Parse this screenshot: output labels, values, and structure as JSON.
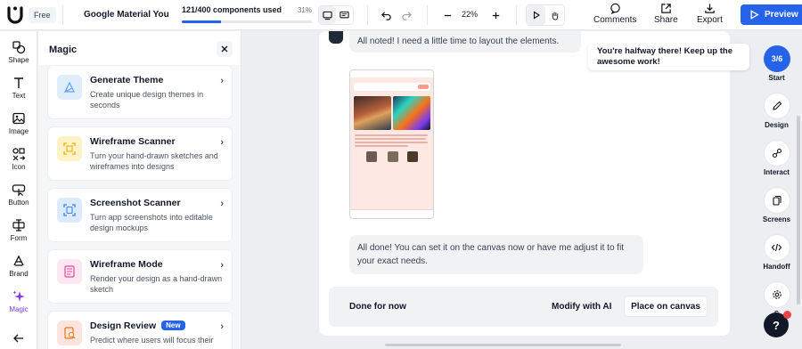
{
  "topbar": {
    "plan": "Free",
    "project_name": "Google Material You",
    "usage_text": "121/400 components used",
    "usage_percent": "31%",
    "usage_fraction": 0.3025,
    "zoom": "22%",
    "comments_label": "Comments",
    "share_label": "Share",
    "export_label": "Export",
    "preview_label": "Preview"
  },
  "rail": {
    "items": [
      {
        "label": "Shape",
        "icon": "shape-icon"
      },
      {
        "label": "Text",
        "icon": "text-icon"
      },
      {
        "label": "Image",
        "icon": "image-icon"
      },
      {
        "label": "Icon",
        "icon": "icon-icon"
      },
      {
        "label": "Button",
        "icon": "button-icon"
      },
      {
        "label": "Form",
        "icon": "form-icon"
      },
      {
        "label": "Brand",
        "icon": "brand-icon"
      },
      {
        "label": "Magic",
        "icon": "magic-icon"
      }
    ]
  },
  "panel": {
    "title": "Magic",
    "cards": [
      {
        "title": "Generate Theme",
        "desc": "Create unique design themes in seconds",
        "icon": "theme-icon"
      },
      {
        "title": "Wireframe Scanner",
        "desc": "Turn your hand-drawn sketches and wireframes into designs",
        "icon": "scanner-icon"
      },
      {
        "title": "Screenshot Scanner",
        "desc": "Turn app screenshots into editable design mockups",
        "icon": "screenshot-icon"
      },
      {
        "title": "Wireframe Mode",
        "desc": "Render your design as a hand-drawn sketch",
        "icon": "wireframe-icon"
      },
      {
        "title": "Design Review",
        "badge": "New",
        "desc": "Predict where users will focus their",
        "icon": "review-icon"
      }
    ]
  },
  "chat": {
    "msg1": "All noted! I need a little time to layout the elements.",
    "msg2": "All done! You can set it on the canvas now or have me adjust it to fit your exact needs.",
    "done_label": "Done for now",
    "modify_label": "Modify with AI",
    "place_label": "Place on canvas"
  },
  "tooltip": "You're halfway there! Keep up the awesome work!",
  "right_rail": {
    "progress": "3/6",
    "items": [
      {
        "label": "Start"
      },
      {
        "label": "Design",
        "icon": "pencil-icon"
      },
      {
        "label": "Interact",
        "icon": "link-icon"
      },
      {
        "label": "Screens",
        "icon": "screens-icon"
      },
      {
        "label": "Handoff",
        "icon": "code-icon"
      },
      {
        "label": "S",
        "icon": "settings-icon"
      }
    ],
    "help": "?"
  },
  "colors": {
    "accent": "#2563eb",
    "magic": "#7c3aed"
  }
}
